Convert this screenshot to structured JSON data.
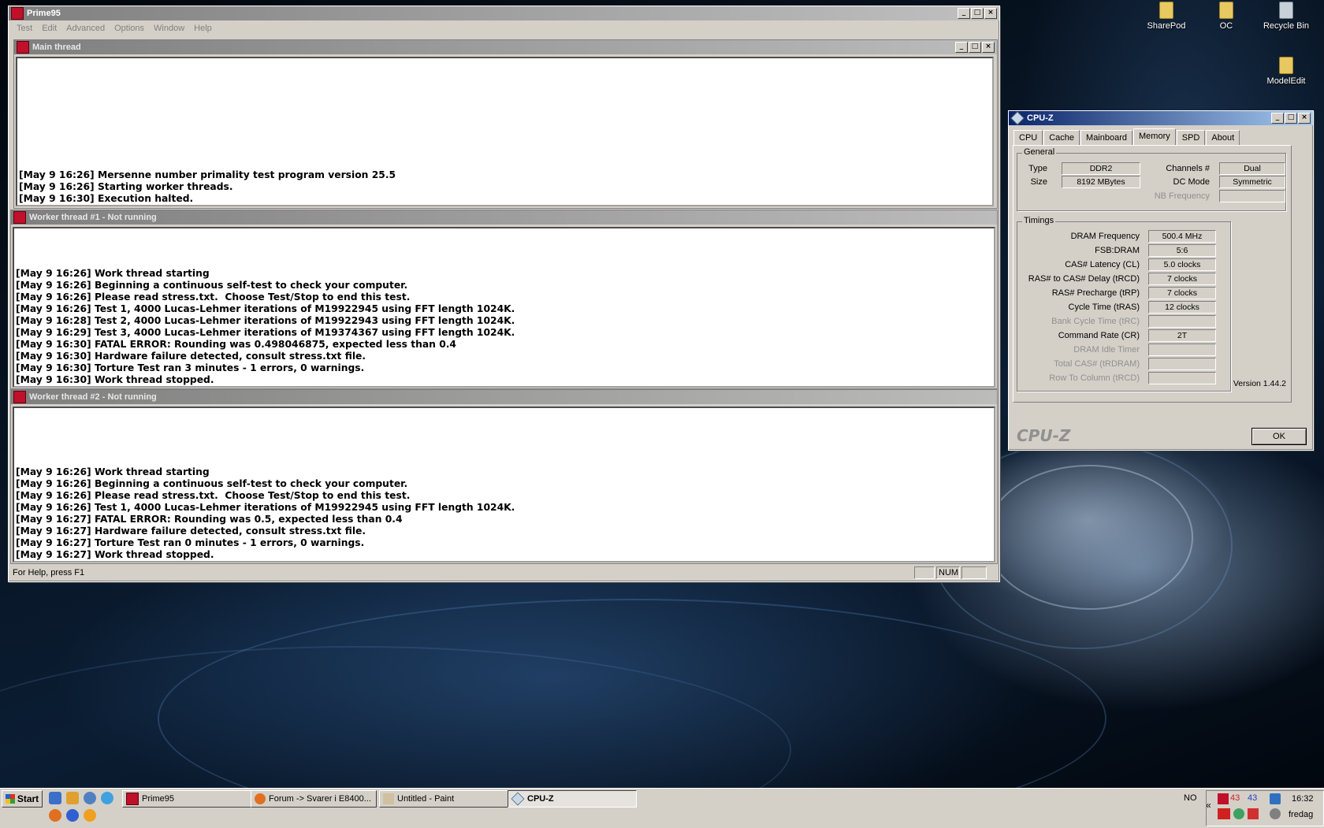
{
  "desktop": {
    "icons": [
      {
        "label": "SharePod"
      },
      {
        "label": "OC"
      },
      {
        "label": "Recycle Bin"
      },
      {
        "label": "ModelEdit"
      }
    ]
  },
  "prime95": {
    "title": "Prime95",
    "menu": [
      "Test",
      "Edit",
      "Advanced",
      "Options",
      "Window",
      "Help"
    ],
    "main_thread": {
      "title": "Main thread",
      "lines": [
        "[May 9 16:26] Mersenne number primality test program version 25.5",
        "[May 9 16:26] Starting worker threads.",
        "[May 9 16:30] Execution halted."
      ]
    },
    "worker1": {
      "title": "Worker thread #1 - Not running",
      "lines": [
        "[May 9 16:26] Work thread starting",
        "[May 9 16:26] Beginning a continuous self-test to check your computer.",
        "[May 9 16:26] Please read stress.txt.  Choose Test/Stop to end this test.",
        "[May 9 16:26] Test 1, 4000 Lucas-Lehmer iterations of M19922945 using FFT length 1024K.",
        "[May 9 16:28] Test 2, 4000 Lucas-Lehmer iterations of M19922943 using FFT length 1024K.",
        "[May 9 16:29] Test 3, 4000 Lucas-Lehmer iterations of M19374367 using FFT length 1024K.",
        "[May 9 16:30] FATAL ERROR: Rounding was 0.498046875, expected less than 0.4",
        "[May 9 16:30] Hardware failure detected, consult stress.txt file.",
        "[May 9 16:30] Torture Test ran 3 minutes - 1 errors, 0 warnings.",
        "[May 9 16:30] Work thread stopped."
      ]
    },
    "worker2": {
      "title": "Worker thread #2 - Not running",
      "lines": [
        "[May 9 16:26] Work thread starting",
        "[May 9 16:26] Beginning a continuous self-test to check your computer.",
        "[May 9 16:26] Please read stress.txt.  Choose Test/Stop to end this test.",
        "[May 9 16:26] Test 1, 4000 Lucas-Lehmer iterations of M19922945 using FFT length 1024K.",
        "[May 9 16:27] FATAL ERROR: Rounding was 0.5, expected less than 0.4",
        "[May 9 16:27] Hardware failure detected, consult stress.txt file.",
        "[May 9 16:27] Torture Test ran 0 minutes - 1 errors, 0 warnings.",
        "[May 9 16:27] Work thread stopped."
      ]
    },
    "status": {
      "help": "For Help, press F1",
      "num": "NUM"
    }
  },
  "cpuz": {
    "title": "CPU-Z",
    "tabs": [
      "CPU",
      "Cache",
      "Mainboard",
      "Memory",
      "SPD",
      "About"
    ],
    "active_tab": "Memory",
    "general": {
      "label": "General",
      "type_label": "Type",
      "type": "DDR2",
      "size_label": "Size",
      "size": "8192 MBytes",
      "channels_label": "Channels #",
      "channels": "Dual",
      "dcmode_label": "DC Mode",
      "dcmode": "Symmetric",
      "nbfreq_label": "NB Frequency",
      "nbfreq": ""
    },
    "timings": {
      "label": "Timings",
      "rows": [
        {
          "label": "DRAM Frequency",
          "value": "500.4 MHz",
          "dim": false
        },
        {
          "label": "FSB:DRAM",
          "value": "5:6",
          "dim": false
        },
        {
          "label": "CAS# Latency (CL)",
          "value": "5.0 clocks",
          "dim": false
        },
        {
          "label": "RAS# to CAS# Delay (tRCD)",
          "value": "7 clocks",
          "dim": false
        },
        {
          "label": "RAS# Precharge (tRP)",
          "value": "7 clocks",
          "dim": false
        },
        {
          "label": "Cycle Time (tRAS)",
          "value": "12 clocks",
          "dim": false
        },
        {
          "label": "Bank Cycle Time (tRC)",
          "value": "",
          "dim": true
        },
        {
          "label": "Command Rate (CR)",
          "value": "2T",
          "dim": false
        },
        {
          "label": "DRAM Idle Timer",
          "value": "",
          "dim": true
        },
        {
          "label": "Total CAS# (tRDRAM)",
          "value": "",
          "dim": true
        },
        {
          "label": "Row To Column (tRCD)",
          "value": "",
          "dim": true
        }
      ]
    },
    "version": "Version 1.44.2",
    "brand": "CPU-Z",
    "ok_label": "OK"
  },
  "taskbar": {
    "start_label": "Start",
    "tasks": [
      {
        "label": "Prime95"
      },
      {
        "label": "Forum -> Svarer i E8400..."
      },
      {
        "label": "Untitled - Paint"
      },
      {
        "label": "CPU-Z"
      }
    ],
    "lang": "NO",
    "temp1": "43",
    "temp2": "43",
    "time": "16:32",
    "day": "fredag"
  }
}
